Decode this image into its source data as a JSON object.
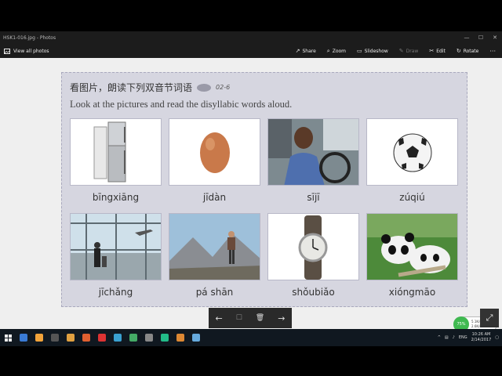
{
  "window": {
    "title": "HSK1-016.jpg - Photos",
    "controls": [
      "—",
      "☐",
      "✕"
    ]
  },
  "cmdbar": {
    "view_all": "View all photos",
    "commands": [
      {
        "icon": "share-icon",
        "glyph": "↗",
        "label": "Share",
        "enabled": true
      },
      {
        "icon": "zoom-icon",
        "glyph": "⌕",
        "label": "Zoom",
        "enabled": true
      },
      {
        "icon": "slideshow-icon",
        "glyph": "▭",
        "label": "Slideshow",
        "enabled": true
      },
      {
        "icon": "draw-icon",
        "glyph": "✎",
        "label": "Draw",
        "enabled": false
      },
      {
        "icon": "edit-icon",
        "glyph": "✂",
        "label": "Edit",
        "enabled": true
      },
      {
        "icon": "rotate-icon",
        "glyph": "↻",
        "label": "Rotate",
        "enabled": true
      }
    ],
    "more": "···"
  },
  "page": {
    "zh_title": "看图片，朗读下列双音节词语",
    "track": "02-6",
    "en_title": "Look at the pictures and read the disyllabic words aloud.",
    "cards": [
      {
        "caption": "bīngxiāng",
        "picture": "refrigerator"
      },
      {
        "caption": "jīdàn",
        "picture": "egg"
      },
      {
        "caption": "sījī",
        "picture": "driver"
      },
      {
        "caption": "zúqiú",
        "picture": "soccer-ball"
      },
      {
        "caption": "jīchǎng",
        "picture": "airport"
      },
      {
        "caption": "pá shān",
        "picture": "hiker"
      },
      {
        "caption": "shǒubiǎo",
        "picture": "wristwatch"
      },
      {
        "caption": "xióngmāo",
        "picture": "panda"
      }
    ]
  },
  "floatbar": {
    "prev": "←",
    "info": "☐",
    "delete": "🗑",
    "next": "→"
  },
  "network_widget": {
    "percent": "75%",
    "up": "5.1K/s",
    "down": "2.6K/s"
  },
  "taskbar": {
    "time": "10:26 AM",
    "date": "2/14/2017",
    "lang": "ENG",
    "app_colors": [
      "#3a7bd5",
      "#f2a33a",
      "#555",
      "#e0a040",
      "#e06030",
      "#d33",
      "#3aa0d0",
      "#4a6",
      "#888",
      "#2b8",
      "#d83",
      "#6ad"
    ]
  },
  "colors": {
    "page_bg": "#d6d6e0",
    "accent": "#0078d7"
  }
}
